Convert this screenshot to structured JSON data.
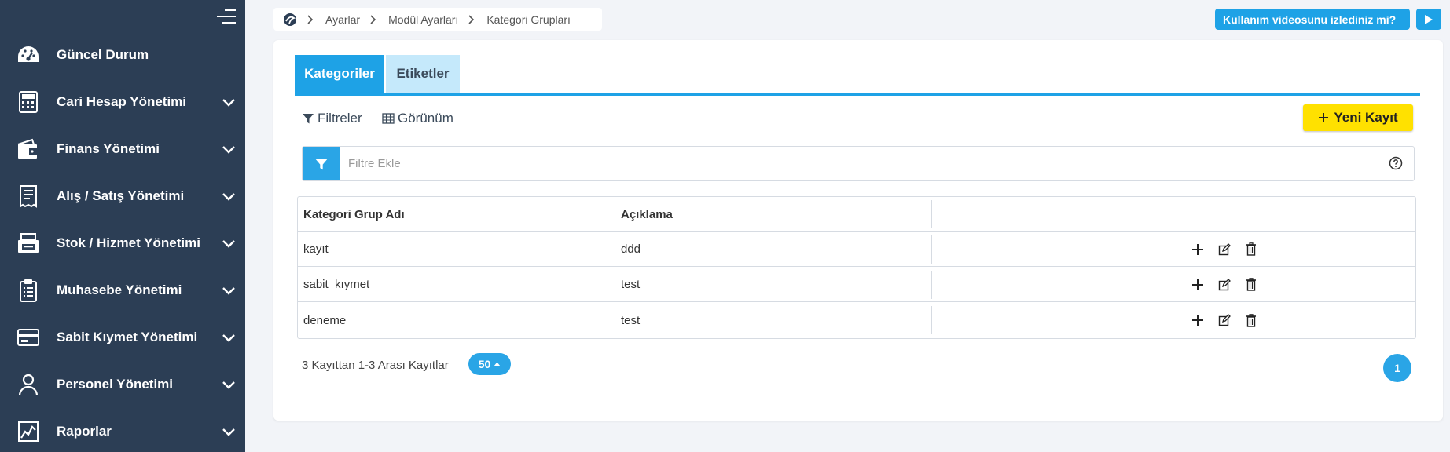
{
  "sidebar": {
    "items": [
      {
        "label": "Güncel Durum",
        "icon": "dashboard-gauge-icon"
      },
      {
        "label": "Cari Hesap Yönetimi",
        "icon": "calculator-icon"
      },
      {
        "label": "Finans Yönetimi",
        "icon": "wallet-icon"
      },
      {
        "label": "Alış / Satış Yönetimi",
        "icon": "receipt-icon"
      },
      {
        "label": "Stok / Hizmet Yönetimi",
        "icon": "stock-box-icon"
      },
      {
        "label": "Muhasebe Yönetimi",
        "icon": "clipboard-icon"
      },
      {
        "label": "Sabit Kıymet Yönetimi",
        "icon": "credit-card-icon"
      },
      {
        "label": "Personel Yönetimi",
        "icon": "person-icon"
      },
      {
        "label": "Raporlar",
        "icon": "report-chart-icon"
      }
    ]
  },
  "breadcrumb": {
    "items": [
      "Ayarlar",
      "Modül Ayarları",
      "Kategori Grupları"
    ]
  },
  "video_prompt": {
    "label": "Kullanım videosunu izlediniz mi?"
  },
  "tabs": [
    {
      "label": "Kategoriler",
      "active": true
    },
    {
      "label": "Etiketler",
      "active": false
    }
  ],
  "toolbar": {
    "filters_label": "Filtreler",
    "view_label": "Görünüm",
    "new_record_label": "Yeni Kayıt"
  },
  "filter": {
    "placeholder": "Filtre Ekle",
    "value": ""
  },
  "table": {
    "columns": [
      "Kategori Grup Adı",
      "Açıklama"
    ],
    "rows": [
      {
        "name": "kayıt",
        "description": "ddd"
      },
      {
        "name": "sabit_kıymet",
        "description": "test"
      },
      {
        "name": "deneme",
        "description": "test"
      }
    ]
  },
  "pagination": {
    "summary": "3 Kayıttan 1-3 Arası Kayıtlar",
    "page_size": "50",
    "current_page": "1"
  },
  "colors": {
    "sidebar_bg": "#2c3e55",
    "accent": "#1ea2e6",
    "tab_inactive": "#c5e9fb",
    "new_button": "#ffe100"
  }
}
